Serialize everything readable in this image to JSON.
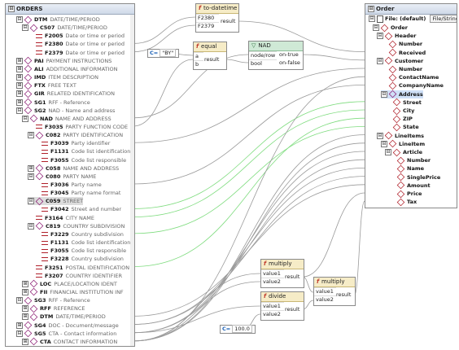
{
  "source": {
    "title": "ORDERS",
    "rows": [
      {
        "toggle": "⊟",
        "icon": "group",
        "name": "DTM",
        "desc": "DATE/TIME/PERIOD"
      },
      {
        "toggle": "⊟",
        "icon": "group",
        "name": "C507",
        "desc": "DATE/TIME/PERIOD"
      },
      {
        "toggle": "",
        "icon": "attr",
        "name": "F2005",
        "desc": "Date or time or period"
      },
      {
        "toggle": "",
        "icon": "attr",
        "name": "F2380",
        "desc": "Date or time or period"
      },
      {
        "toggle": "",
        "icon": "attr",
        "name": "F2379",
        "desc": "Date or time or period"
      },
      {
        "toggle": "⊞",
        "icon": "group",
        "name": "PAI",
        "desc": "PAYMENT INSTRUCTIONS"
      },
      {
        "toggle": "⊞",
        "icon": "group",
        "name": "ALI",
        "desc": "ADDITIONAL INFORMATION"
      },
      {
        "toggle": "⊞",
        "icon": "group",
        "name": "IMD",
        "desc": "ITEM DESCRIPTION"
      },
      {
        "toggle": "⊞",
        "icon": "group",
        "name": "FTX",
        "desc": "FREE TEXT"
      },
      {
        "toggle": "⊞",
        "icon": "group",
        "name": "GIR",
        "desc": "RELATED IDENTIFICATION"
      },
      {
        "toggle": "⊞",
        "icon": "group",
        "name": "SG1",
        "desc": "RFF - Reference"
      },
      {
        "toggle": "⊟",
        "icon": "group",
        "name": "SG2",
        "desc": "NAD - Name and address"
      },
      {
        "toggle": "⊟",
        "icon": "group",
        "name": "NAD",
        "desc": "NAME AND ADDRESS"
      },
      {
        "toggle": "",
        "icon": "attr",
        "name": "F3035",
        "desc": "PARTY FUNCTION CODE"
      },
      {
        "toggle": "⊟",
        "icon": "group",
        "name": "C082",
        "desc": "PARTY IDENTIFICATION"
      },
      {
        "toggle": "",
        "icon": "attr",
        "name": "F3039",
        "desc": "Party identifier"
      },
      {
        "toggle": "",
        "icon": "attr",
        "name": "F1131",
        "desc": "Code list identification"
      },
      {
        "toggle": "",
        "icon": "attr",
        "name": "F3055",
        "desc": "Code list responsible"
      },
      {
        "toggle": "⊞",
        "icon": "group",
        "name": "C058",
        "desc": "NAME AND ADDRESS"
      },
      {
        "toggle": "⊟",
        "icon": "group",
        "name": "C080",
        "desc": "PARTY NAME"
      },
      {
        "toggle": "",
        "icon": "attr",
        "name": "F3036",
        "desc": "Party name"
      },
      {
        "toggle": "",
        "icon": "attr",
        "name": "F3045",
        "desc": "Party name format"
      },
      {
        "toggle": "⊟",
        "icon": "group",
        "name": "C059",
        "desc": "STREET"
      },
      {
        "toggle": "",
        "icon": "attr",
        "name": "F3042",
        "desc": "Street and number"
      },
      {
        "toggle": "",
        "icon": "attr",
        "name": "F3164",
        "desc": "CITY NAME"
      },
      {
        "toggle": "⊟",
        "icon": "group",
        "name": "C819",
        "desc": "COUNTRY SUBDIVISION"
      },
      {
        "toggle": "",
        "icon": "attr",
        "name": "F3229",
        "desc": "Country subdivision"
      },
      {
        "toggle": "",
        "icon": "attr",
        "name": "F1131",
        "desc": "Code list identification"
      },
      {
        "toggle": "",
        "icon": "attr",
        "name": "F3055",
        "desc": "Code list responsible"
      },
      {
        "toggle": "",
        "icon": "attr",
        "name": "F3228",
        "desc": "Country subdivision"
      },
      {
        "toggle": "",
        "icon": "attr",
        "name": "F3251",
        "desc": "POSTAL IDENTIFICATION"
      },
      {
        "toggle": "",
        "icon": "attr",
        "name": "F3207",
        "desc": "COUNTRY IDENTIFIER"
      },
      {
        "toggle": "⊞",
        "icon": "group",
        "name": "LOC",
        "desc": "PLACE/LOCATION IDENT"
      },
      {
        "toggle": "⊞",
        "icon": "group",
        "name": "FII",
        "desc": "FINANCIAL INSTITUTION INF"
      },
      {
        "toggle": "⊟",
        "icon": "group",
        "name": "SG3",
        "desc": "RFF - Reference"
      },
      {
        "toggle": "⊞",
        "icon": "group",
        "name": "RFF",
        "desc": "REFERENCE"
      },
      {
        "toggle": "⊞",
        "icon": "group",
        "name": "DTM",
        "desc": "DATE/TIME/PERIOD"
      },
      {
        "toggle": "⊞",
        "icon": "group",
        "name": "SG4",
        "desc": "DOC - Document/message"
      },
      {
        "toggle": "⊟",
        "icon": "group",
        "name": "SG5",
        "desc": "CTA - Contact information"
      },
      {
        "toggle": "⊞",
        "icon": "group",
        "name": "CTA",
        "desc": "CONTACT INFORMATION"
      }
    ]
  },
  "target": {
    "title": "Order",
    "file_label": "File: (default)",
    "file_button": "File/String",
    "rows": [
      {
        "toggle": "⊟",
        "icon": "elem",
        "name": "Order"
      },
      {
        "toggle": "⊟",
        "icon": "elem",
        "name": "Header"
      },
      {
        "toggle": "",
        "icon": "elem",
        "name": "Number"
      },
      {
        "toggle": "",
        "icon": "elem",
        "name": "Received"
      },
      {
        "toggle": "⊟",
        "icon": "elem",
        "name": "Customer"
      },
      {
        "toggle": "",
        "icon": "elem",
        "name": "Number"
      },
      {
        "toggle": "",
        "icon": "elem",
        "name": "ContactName"
      },
      {
        "toggle": "",
        "icon": "elem",
        "name": "CompanyName"
      },
      {
        "toggle": "⊟",
        "icon": "group",
        "name": "Address"
      },
      {
        "toggle": "",
        "icon": "elem",
        "name": "Street"
      },
      {
        "toggle": "",
        "icon": "elem",
        "name": "City"
      },
      {
        "toggle": "",
        "icon": "elem",
        "name": "ZIP"
      },
      {
        "toggle": "",
        "icon": "elem",
        "name": "State"
      },
      {
        "toggle": "⊟",
        "icon": "elem",
        "name": "LineItems"
      },
      {
        "toggle": "⊟",
        "icon": "elem",
        "name": "LineItem"
      },
      {
        "toggle": "⊟",
        "icon": "elem",
        "name": "Article"
      },
      {
        "toggle": "",
        "icon": "elem",
        "name": "Number"
      },
      {
        "toggle": "",
        "icon": "elem",
        "name": "Name"
      },
      {
        "toggle": "",
        "icon": "elem",
        "name": "SinglePrice"
      },
      {
        "toggle": "",
        "icon": "elem",
        "name": "Amount"
      },
      {
        "toggle": "",
        "icon": "elem",
        "name": "Price"
      },
      {
        "toggle": "",
        "icon": "elem",
        "name": "Tax"
      }
    ]
  },
  "to_datetime": {
    "title": "to-datetime",
    "in1": "F2380",
    "in2": "F2379",
    "out": "result"
  },
  "equal": {
    "title": "equal",
    "in1": "a",
    "in2": "b",
    "out": "result"
  },
  "constant_by": {
    "tag": "C=",
    "value": "\"BY\""
  },
  "nad_filter": {
    "title": "NAD",
    "in1": "node/row",
    "in2": "bool",
    "out1": "on-true",
    "out2": "on-false"
  },
  "multiply1": {
    "title": "multiply",
    "in1": "value1",
    "in2": "value2",
    "out": "result"
  },
  "divide": {
    "title": "divide",
    "in1": "value1",
    "in2": "value2",
    "out": "result"
  },
  "multiply2": {
    "title": "multiply",
    "in1": "value1",
    "in2": "value2",
    "out": "result"
  },
  "constant_100": {
    "tag": "C=",
    "value": "100.0"
  },
  "colors": {
    "wire": "#9a9a9a",
    "wire_green": "#7fdc7f",
    "function_header": "#f6ecc7",
    "filter_header": "#cfe9d6",
    "element_icon": "#b0202a"
  }
}
